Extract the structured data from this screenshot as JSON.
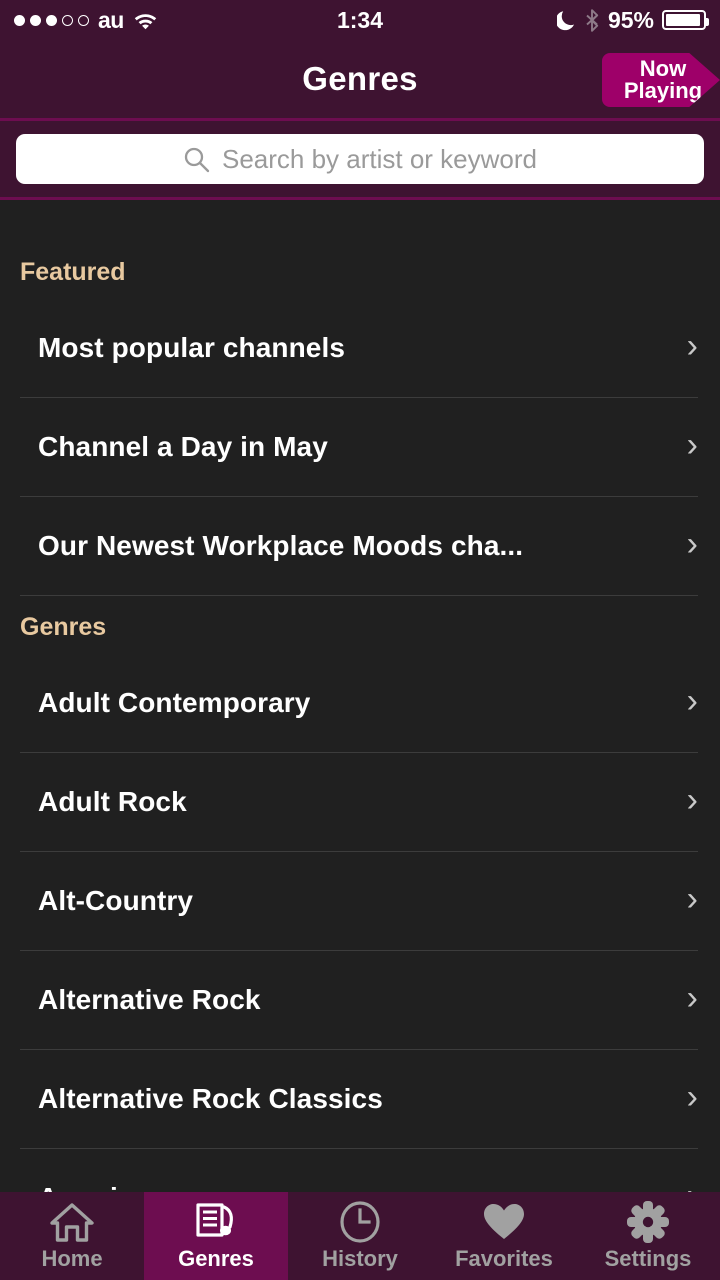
{
  "status_bar": {
    "signal_dots_filled": 3,
    "signal_dots_total": 5,
    "carrier": "au",
    "wifi_icon": "wifi-icon",
    "time": "1:34",
    "dnd_icon": "moon-icon",
    "bluetooth_icon": "bluetooth-icon",
    "battery_percent": "95%",
    "battery_level": 95
  },
  "navbar": {
    "title": "Genres",
    "now_playing_line1": "Now",
    "now_playing_line2": "Playing",
    "accent_color": "#9e0069",
    "bar_color": "#3e1331"
  },
  "search": {
    "placeholder": "Search by artist or keyword",
    "value": "",
    "icon": "search-icon"
  },
  "sections": [
    {
      "header": "Featured",
      "header_color": "#e8c9a0",
      "items": [
        {
          "label": "Most popular channels",
          "chevron": "chevron-right-icon"
        },
        {
          "label": "Channel a Day in May",
          "chevron": "chevron-right-icon"
        },
        {
          "label": "Our Newest Workplace Moods cha...",
          "chevron": "chevron-right-icon"
        }
      ]
    },
    {
      "header": "Genres",
      "header_color": "#e8c9a0",
      "items": [
        {
          "label": "Adult Contemporary",
          "chevron": "chevron-right-icon"
        },
        {
          "label": "Adult Rock",
          "chevron": "chevron-right-icon"
        },
        {
          "label": "Alt-Country",
          "chevron": "chevron-right-icon"
        },
        {
          "label": "Alternative Rock",
          "chevron": "chevron-right-icon"
        },
        {
          "label": "Alternative Rock Classics",
          "chevron": "chevron-right-icon"
        },
        {
          "label": "Americana",
          "chevron": "chevron-right-icon"
        }
      ]
    }
  ],
  "tabbar": {
    "active_index": 1,
    "active_bg": "#6d0d50",
    "tabs": [
      {
        "label": "Home",
        "icon": "home-icon"
      },
      {
        "label": "Genres",
        "icon": "genres-list-music-icon"
      },
      {
        "label": "History",
        "icon": "clock-icon"
      },
      {
        "label": "Favorites",
        "icon": "heart-icon"
      },
      {
        "label": "Settings",
        "icon": "gear-icon"
      }
    ]
  }
}
